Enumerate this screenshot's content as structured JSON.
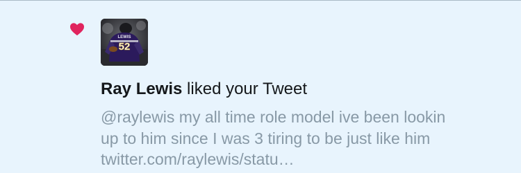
{
  "notification": {
    "type_icon": "heart-icon",
    "avatar_icon": "user-avatar-photo",
    "user_name": "Ray Lewis",
    "action_text": " liked your Tweet",
    "tweet_lines": [
      "@raylewis my all time role model ive been lookin",
      "up to him since I was 3 tiring to be just like him",
      "twitter.com/raylewis/statu…"
    ],
    "jersey_number": "52",
    "jersey_name": "LEWIS"
  },
  "colors": {
    "background": "#e8f4fd",
    "heart": "#e0245e",
    "primary_text": "#14171a",
    "secondary_text": "#8899a6",
    "jersey_purple": "#2b1a5c"
  }
}
